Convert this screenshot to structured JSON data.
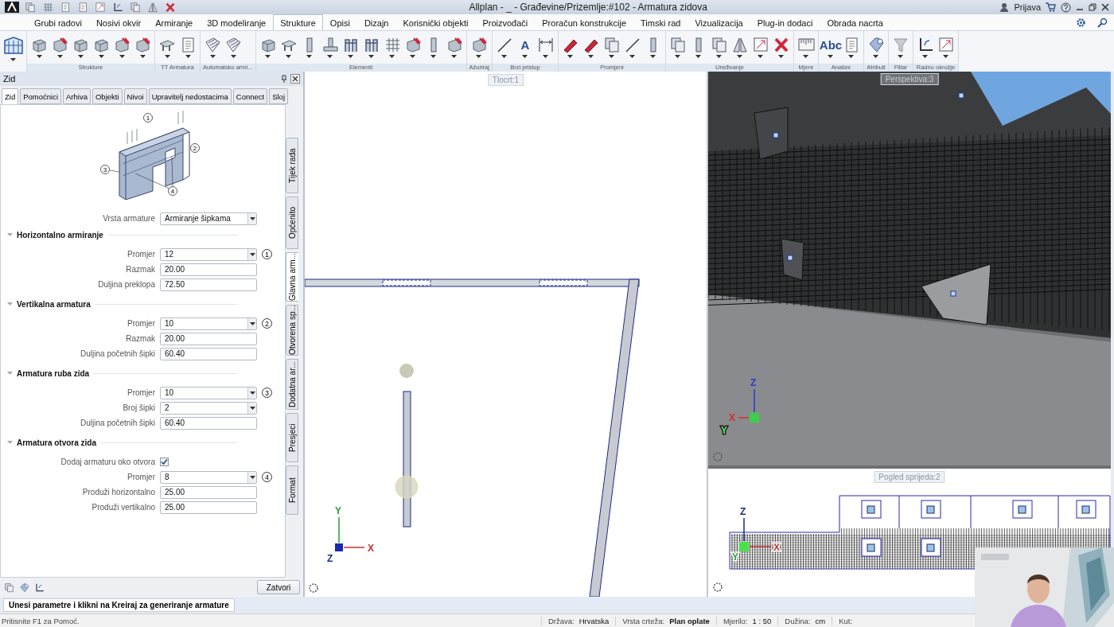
{
  "title_bar": {
    "title": "Allplan - _ - Građevine/Prizemlje:#102 - Armatura zidova",
    "user": "Prijava"
  },
  "ribbon_tabs": [
    {
      "label": "Grubi radovi",
      "selected": false
    },
    {
      "label": "Nosivi okvir",
      "selected": false
    },
    {
      "label": "Armiranje",
      "selected": false
    },
    {
      "label": "3D modeliranje",
      "selected": false
    },
    {
      "label": "Strukture",
      "selected": true
    },
    {
      "label": "Opisi",
      "selected": false
    },
    {
      "label": "Dizajn",
      "selected": false
    },
    {
      "label": "Korisnički objekti",
      "selected": false
    },
    {
      "label": "Proizvođači",
      "selected": false
    },
    {
      "label": "Proračun konstrukcije",
      "selected": false
    },
    {
      "label": "Timski rad",
      "selected": false
    },
    {
      "label": "Vizualizacija",
      "selected": false
    },
    {
      "label": "Plug-in dodaci",
      "selected": false
    },
    {
      "label": "Obrada nacrta",
      "selected": false
    }
  ],
  "ribbon_groups": [
    {
      "label": "Strukture"
    },
    {
      "label": "TT Armatura"
    },
    {
      "label": "Automatsko armi..."
    },
    {
      "label": "Elementi"
    },
    {
      "label": "Ažuriraj"
    },
    {
      "label": "Brzi pristup",
      "text_tools": [
        "A"
      ]
    },
    {
      "label": "Promjeni"
    },
    {
      "label": "Uređivanje"
    },
    {
      "label": "Mjere"
    },
    {
      "label": "Analize",
      "text_tools": [
        "Abc"
      ]
    },
    {
      "label": "Atributi"
    },
    {
      "label": "Filtar"
    },
    {
      "label": "Radno okružje"
    }
  ],
  "panel": {
    "title": "Zid",
    "tabs": [
      {
        "label": "Zid",
        "selected": true
      },
      {
        "label": "Pomoćnici",
        "selected": false
      },
      {
        "label": "Arhiva",
        "selected": false
      },
      {
        "label": "Objekti",
        "selected": false
      },
      {
        "label": "Nivoi",
        "selected": false
      },
      {
        "label": "Upravitelj nedostacima",
        "selected": false
      },
      {
        "label": "Connect",
        "selected": false
      },
      {
        "label": "Sloj",
        "selected": false
      }
    ],
    "side_tabs": [
      {
        "label": "Tijek rada",
        "selected": false
      },
      {
        "label": "Općenito",
        "selected": false
      },
      {
        "label": "Glavna arm...",
        "selected": true
      },
      {
        "label": "Otvorena sp...",
        "selected": false
      },
      {
        "label": "Dodatna ar...",
        "selected": false
      },
      {
        "label": "Presjeci",
        "selected": false
      },
      {
        "label": "Format",
        "selected": false
      }
    ],
    "diagram_callouts": [
      "1",
      "2",
      "3",
      "4"
    ],
    "type_field": {
      "label": "Vrsta armature",
      "value": "Armiranje šipkama"
    },
    "sections": [
      {
        "title": "Horizontalno armiranje",
        "expanded": true,
        "fields": [
          {
            "kind": "select",
            "label": "Promjer",
            "value": "12",
            "callout": "1"
          },
          {
            "kind": "input",
            "label": "Razmak",
            "value": "20.00"
          },
          {
            "kind": "input",
            "label": "Duljina preklopa",
            "value": "72.50"
          }
        ]
      },
      {
        "title": "Vertikalna armatura",
        "expanded": true,
        "fields": [
          {
            "kind": "select",
            "label": "Promjer",
            "value": "10",
            "callout": "2"
          },
          {
            "kind": "input",
            "label": "Razmak",
            "value": "20.00"
          },
          {
            "kind": "input",
            "label": "Duljina početnih šipki",
            "value": "60.40"
          }
        ]
      },
      {
        "title": "Armatura ruba zida",
        "expanded": true,
        "fields": [
          {
            "kind": "select",
            "label": "Promjer",
            "value": "10",
            "callout": "3"
          },
          {
            "kind": "select",
            "label": "Broj šipki",
            "value": "2"
          },
          {
            "kind": "input",
            "label": "Duljina početnih šipki",
            "value": "60.40"
          }
        ]
      },
      {
        "title": "Armatura otvora zida",
        "expanded": true,
        "fields": [
          {
            "kind": "checkbox",
            "label": "Dodaj armaturu oko otvora",
            "checked": true
          },
          {
            "kind": "select",
            "label": "Promjer",
            "value": "8",
            "callout": "4"
          },
          {
            "kind": "input",
            "label": "Produži horizontalno",
            "value": "25.00"
          },
          {
            "kind": "input",
            "label": "Produži vertikalno",
            "value": "25.00"
          }
        ]
      }
    ],
    "close_button": "Zatvori"
  },
  "viewports": [
    {
      "title": "Tlocrt:1",
      "axes": [
        {
          "label": "Y",
          "color": "#2e9a3a"
        },
        {
          "label": "X",
          "color": "#c8302a"
        },
        {
          "label": "Z",
          "color": "#1a2a8a"
        }
      ]
    },
    {
      "title": "Perspektiva:3",
      "axes": [
        {
          "label": "Z",
          "color": "#2a3ad0"
        },
        {
          "label": "X",
          "color": "#d0302a"
        },
        {
          "label": "Y",
          "color": "#5ee86a"
        }
      ]
    },
    {
      "title": "Pogled sprijeda:2",
      "axes": [
        {
          "label": "Z",
          "color": "#1a2a8a"
        },
        {
          "label": "X",
          "color": "#c8302a"
        },
        {
          "label": "Y",
          "color": "#2ea03a"
        }
      ]
    }
  ],
  "message": "Unesi parametre i klikni na Kreiraj za generiranje armature",
  "status_bar": {
    "hint": "Pritisnite F1 za Pomoć.",
    "items": [
      {
        "label": "Država:",
        "value": "Hrvatska"
      },
      {
        "label": "Vrsta crteža:",
        "value": "Plan oplate"
      },
      {
        "label": "Mjerilo:",
        "value": "1 : 50"
      },
      {
        "label": "Dužina:",
        "value": "cm"
      },
      {
        "label": "Kut:"
      }
    ]
  }
}
